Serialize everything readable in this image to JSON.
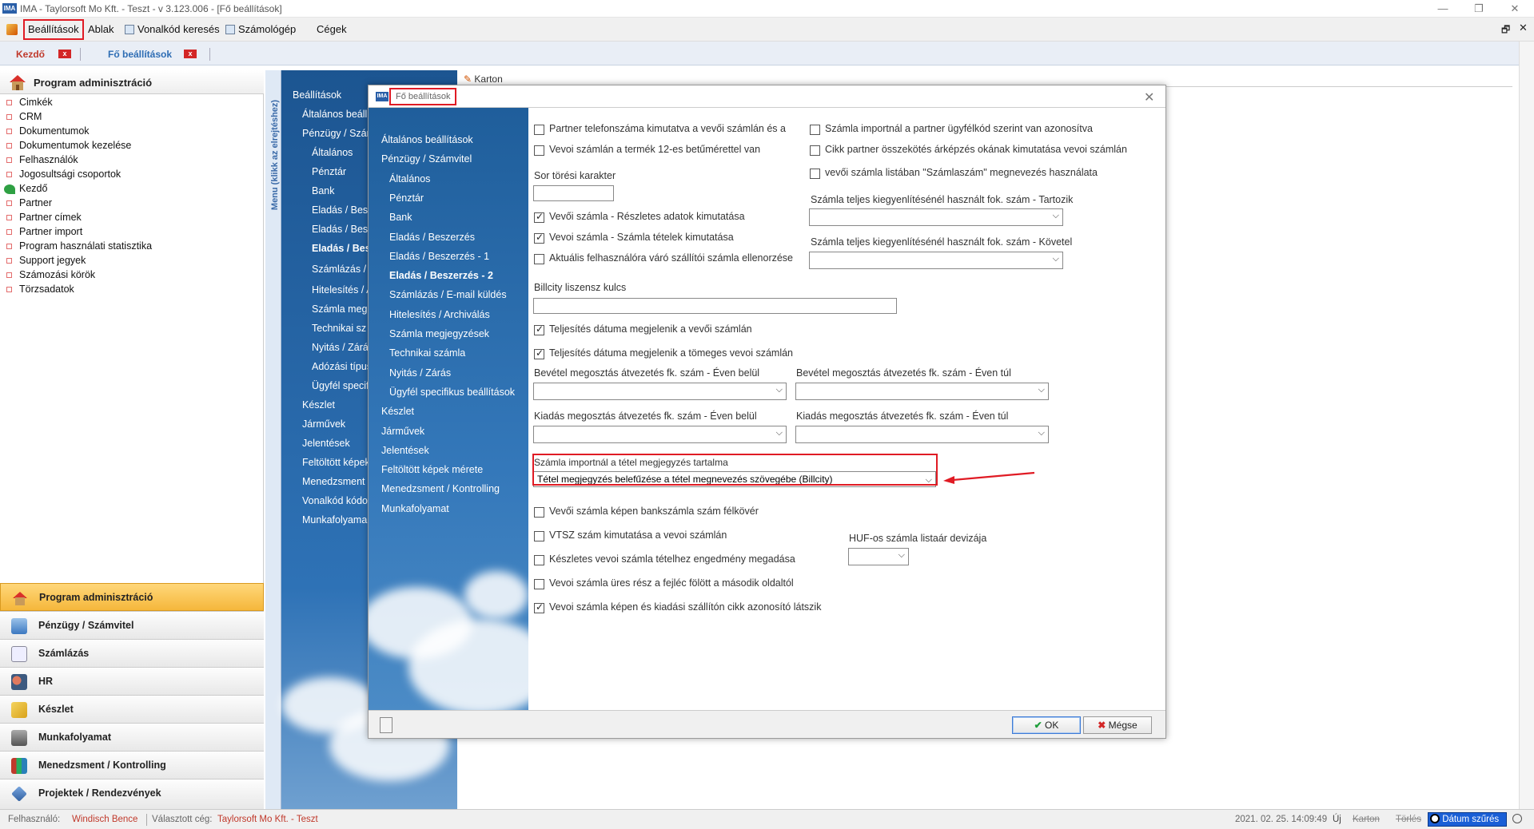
{
  "window": {
    "title": "IMA - Taylorsoft Mo Kft. - Teszt - v 3.123.006 - [Fő beállítások]",
    "app_icon_text": "IMA",
    "minimize": "—",
    "restore": "❐",
    "close": "✕"
  },
  "menubar": {
    "items": [
      "Beállítások",
      "Ablak",
      "Vonalkód keresés",
      "Számológép",
      "Cégek"
    ],
    "right_restore": "🗗",
    "right_close": "✕"
  },
  "tabs": [
    {
      "label": "Kezdő",
      "close": "x"
    },
    {
      "label": "Fő beállítások",
      "close": "x"
    }
  ],
  "left_panel": {
    "header": "Program adminisztráció",
    "items": [
      "Cimkék",
      "CRM",
      "Dokumentumok",
      "Dokumentumok kezelése",
      "Felhasználók",
      "Jogosultsági csoportok",
      "Kezdő",
      "Partner",
      "Partner címek",
      "Partner import",
      "Program használati statisztika",
      "Support jegyek",
      "Számozási körök",
      "Törzsadatok"
    ],
    "vertical_label": "Menu (klikk az elrejtéshez)"
  },
  "bottom_nav": [
    "Program adminisztráció",
    "Pénzügy / Számvitel",
    "Számlázás",
    "HR",
    "Készlet",
    "Munkafolyamat",
    "Menedzsment / Kontrolling",
    "Projektek / Rendezvények"
  ],
  "bg_nav": [
    "Beállítások",
    "Általános beáll",
    "Pénzügy / Szám",
    "Általános",
    "Pénztár",
    "Bank",
    "Eladás / Besz",
    "Eladás / Besz",
    "Eladás / Bes",
    "Számlázás /",
    "Hitelesítés / A",
    "Számla meg",
    "Technikai sz",
    "Nyitás / Zárá",
    "Adózási típus",
    "Ügyfél specif",
    "Készlet",
    "Járművek",
    "Jelentések",
    "Feltöltött képek",
    "Menedzsment",
    "Vonalkód kódo",
    "Munkafolyama"
  ],
  "main_tab": "Karton",
  "dialog": {
    "title": "Fő beállítások",
    "close": "✕",
    "nav": [
      "Általános beállítások",
      "Pénzügy / Számvitel",
      "Általános",
      "Pénztár",
      "Bank",
      "Eladás / Beszerzés",
      "Eladás / Beszerzés - 1",
      "Eladás / Beszerzés - 2",
      "Számlázás / E-mail küldés",
      "Hitelesítés / Archiválás",
      "Számla megjegyzések",
      "Technikai számla",
      "Nyitás / Zárás",
      "Ügyfél specifikus beállítások",
      "Készlet",
      "Járművek",
      "Jelentések",
      "Feltöltött képek mérete",
      "Menedzsment / Kontrolling",
      "Munkafolyamat"
    ],
    "left_checks_top": [
      {
        "label": "Partner telefonszáma kimutatva a vevői számlán és a",
        "checked": false
      },
      {
        "label": "Vevoi számlán a termék 12-es betűmérettel van",
        "checked": false
      }
    ],
    "sor_torlesi_label": "Sor törési karakter",
    "sor_torlesi_value": "",
    "left_checks_mid": [
      {
        "label": "Vevői számla - Részletes adatok kimutatása",
        "checked": true
      },
      {
        "label": "Vevoi számla - Számla tételek kimutatása",
        "checked": true
      },
      {
        "label": "Aktuális felhasználóra váró szállítói számla ellenorzése",
        "checked": false
      }
    ],
    "billcity_label": "Billcity liszensz kulcs",
    "billcity_value": "",
    "teljesites_checks": [
      {
        "label": "Teljesítés dátuma megjelenik a vevői számlán",
        "checked": true
      },
      {
        "label": "Teljesítés dátuma megjelenik a tömeges vevoi számlán",
        "checked": true
      }
    ],
    "right_checks": [
      {
        "label": "Számla importnál a partner ügyfélkód szerint van azonosítva",
        "checked": false
      },
      {
        "label": "Cikk partner összekötés árképzés okának kimutatása vevoi számlán",
        "checked": false
      },
      {
        "label": "vevői számla listában \"Számlaszám\" megnevezés használata",
        "checked": false
      }
    ],
    "tartozik_label": "Számla teljes kiegyenlítésénél használt fok. szám - Tartozik",
    "tartozik_value": "",
    "kovetel_label": "Számla teljes kiegyenlítésénél használt fok. szám - Követel",
    "kovetel_value": "",
    "bevetel_belul_label": "Bevétel megosztás átvezetés fk. szám - Éven belül",
    "bevetel_belul_value": "",
    "bevetel_tul_label": "Bevétel megosztás átvezetés fk. szám - Éven túl",
    "bevetel_tul_value": "",
    "kiadas_belul_label": "Kiadás megosztás átvezetés fk. szám - Éven belül",
    "kiadas_belul_value": "",
    "kiadas_tul_label": "Kiadás megosztás átvezetés fk. szám - Éven túl",
    "kiadas_tul_value": "",
    "import_label": "Számla importnál a tétel megjegyzés tartalma",
    "import_value": "Tétel megjegyzés belefűzése a tétel megnevezés szövegébe (Billcity)",
    "bottom_checks": [
      {
        "label": "Vevői számla képen bankszámla szám félkövér",
        "checked": false
      },
      {
        "label": "VTSZ szám kimutatása a vevoi számlán",
        "checked": false
      },
      {
        "label": "Készletes vevoi számla tételhez engedmény megadása",
        "checked": false
      },
      {
        "label": "Vevoi számla üres rész a fejléc fölött a második oldaltól",
        "checked": false
      },
      {
        "label": "Vevoi számla képen és kiadási szállítón cikk azonosító látszik",
        "checked": true
      }
    ],
    "huf_label": "HUF-os számla listaár devizája",
    "huf_value": "",
    "ok_label": "OK",
    "cancel_label": "Mégse"
  },
  "statusbar": {
    "user_label": "Felhasználó:",
    "user": "Windisch Bence",
    "company_label": "Választott cég:",
    "company": "Taylorsoft Mo Kft. - Teszt",
    "datetime": "2021. 02. 25. 14:09:49",
    "uj": "Új",
    "karton": "Karton",
    "torles": "Törlés",
    "datum_szures": "Dátum szűrés"
  },
  "colors": {
    "accent_red": "#e01b24",
    "nav_blue": "#2e72b6",
    "active_nav": "#f5b73b",
    "status_red": "#c0392b"
  }
}
